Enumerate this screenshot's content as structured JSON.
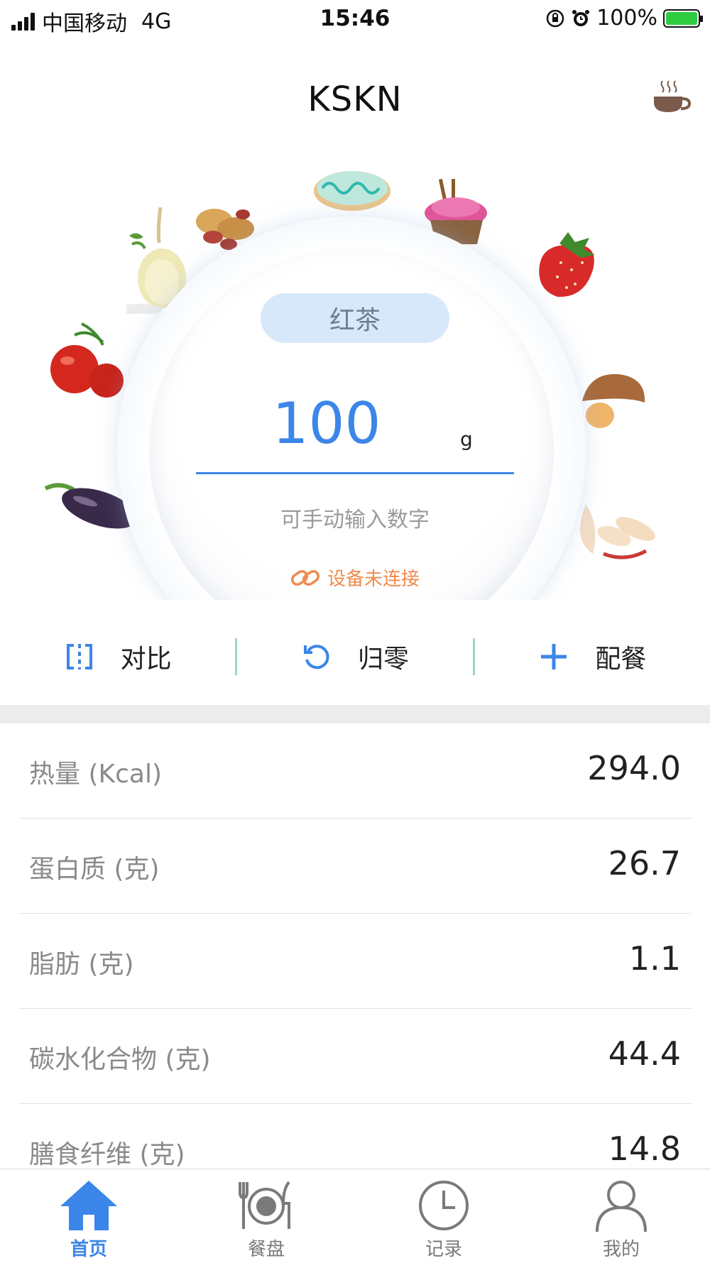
{
  "status_bar": {
    "carrier": "中国移动",
    "network": "4G",
    "time": "15:46",
    "battery": "100%"
  },
  "header": {
    "title": "KSKN",
    "right_icon": "coffee-cup-icon"
  },
  "scale": {
    "food_name": "红茶",
    "weight_value": "100",
    "unit": "g",
    "hint": "可手动输入数字",
    "device_status": "设备未连接",
    "device_icon": "link-icon"
  },
  "actions": [
    {
      "label": "对比",
      "icon": "compare-icon"
    },
    {
      "label": "归零",
      "icon": "reset-icon"
    },
    {
      "label": "配餐",
      "icon": "plus-icon"
    }
  ],
  "nutrition": [
    {
      "label": "热量 (Kcal)",
      "value": "294.0"
    },
    {
      "label": "蛋白质 (克)",
      "value": "26.7"
    },
    {
      "label": "脂肪 (克)",
      "value": "1.1"
    },
    {
      "label": "碳水化合物 (克)",
      "value": "44.4"
    },
    {
      "label": "膳食纤维 (克)",
      "value": "14.8"
    }
  ],
  "tabs": [
    {
      "label": "首页",
      "icon": "home-icon",
      "active": true
    },
    {
      "label": "餐盘",
      "icon": "dinner-plate-icon",
      "active": false
    },
    {
      "label": "记录",
      "icon": "clock-icon",
      "active": false
    },
    {
      "label": "我的",
      "icon": "user-icon",
      "active": false
    }
  ],
  "colors": {
    "accent": "#3b86e8",
    "device_warning": "#ef8a4d",
    "pill_bg": "#d8e8fb",
    "separator": "#9fd6c5"
  }
}
